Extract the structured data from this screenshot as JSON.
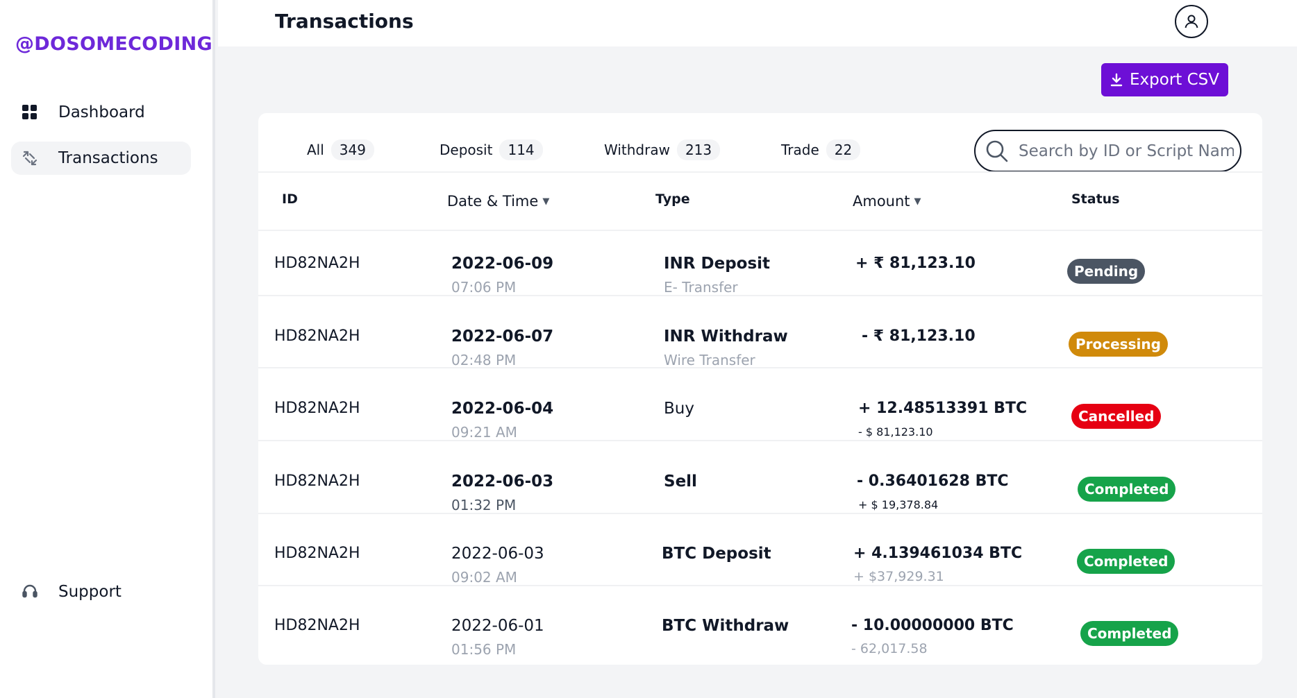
{
  "brand": "@DOSOMECODING",
  "nav": {
    "dashboard": "Dashboard",
    "transactions": "Transactions",
    "support": "Support"
  },
  "header": {
    "title": "Transactions"
  },
  "export_label": "Export CSV",
  "tabs": [
    {
      "label": "All",
      "count": "349"
    },
    {
      "label": "Deposit",
      "count": "114"
    },
    {
      "label": "Withdraw",
      "count": "213"
    },
    {
      "label": "Trade",
      "count": "22"
    }
  ],
  "search": {
    "placeholder": "Search by ID or Script Name"
  },
  "columns": {
    "id": "ID",
    "datetime": "Date & Time",
    "type": "Type",
    "amount": "Amount",
    "status": "Status"
  },
  "rows": [
    {
      "id": "HD82NA2H",
      "date": "2022-06-09",
      "time": "07:06 PM",
      "type": "INR Deposit",
      "type_sub": "E- Transfer",
      "amount": "+ ₹ 81,123.10",
      "amount_sub": "",
      "status": "Pending",
      "status_color": "#4b5563"
    },
    {
      "id": "HD82NA2H",
      "date": "2022-06-07",
      "time": "02:48 PM",
      "type": "INR Withdraw",
      "type_sub": "Wire Transfer",
      "amount": "- ₹ 81,123.10",
      "amount_sub": "",
      "status": "Processing",
      "status_color": "#d08a0b"
    },
    {
      "id": "HD82NA2H",
      "date": "2022-06-04",
      "time": "09:21 AM",
      "type": "Buy",
      "type_sub": "",
      "amount": "+ 12.48513391 BTC",
      "amount_sub": "- $ 81,123.10",
      "status": "Cancelled",
      "status_color": "#e60012"
    },
    {
      "id": "HD82NA2H",
      "date": "2022-06-03",
      "time": "01:32 PM",
      "type": "Sell",
      "type_sub": "",
      "amount": "- 0.36401628 BTC",
      "amount_sub": "+ $ 19,378.84",
      "status": "Completed",
      "status_color": "#16a34a"
    },
    {
      "id": "HD82NA2H",
      "date": "2022-06-03",
      "time": "09:02 AM",
      "type": "BTC Deposit",
      "type_sub": "",
      "amount": "+ 4.139461034 BTC",
      "amount_sub": "+ $37,929.31",
      "status": "Completed",
      "status_color": "#16a34a"
    },
    {
      "id": "HD82NA2H",
      "date": "2022-06-01",
      "time": "01:56 PM",
      "type": "BTC Withdraw",
      "type_sub": "",
      "amount": "- 10.00000000 BTC",
      "amount_sub": "- 62,017.58",
      "status": "Completed",
      "status_color": "#16a34a"
    }
  ],
  "colors": {
    "brand": "#6d28d9",
    "export_button": "#6d0fd6",
    "pending": "#4b5563",
    "processing": "#d08a0b",
    "cancelled": "#e60012",
    "completed": "#16a34a"
  }
}
